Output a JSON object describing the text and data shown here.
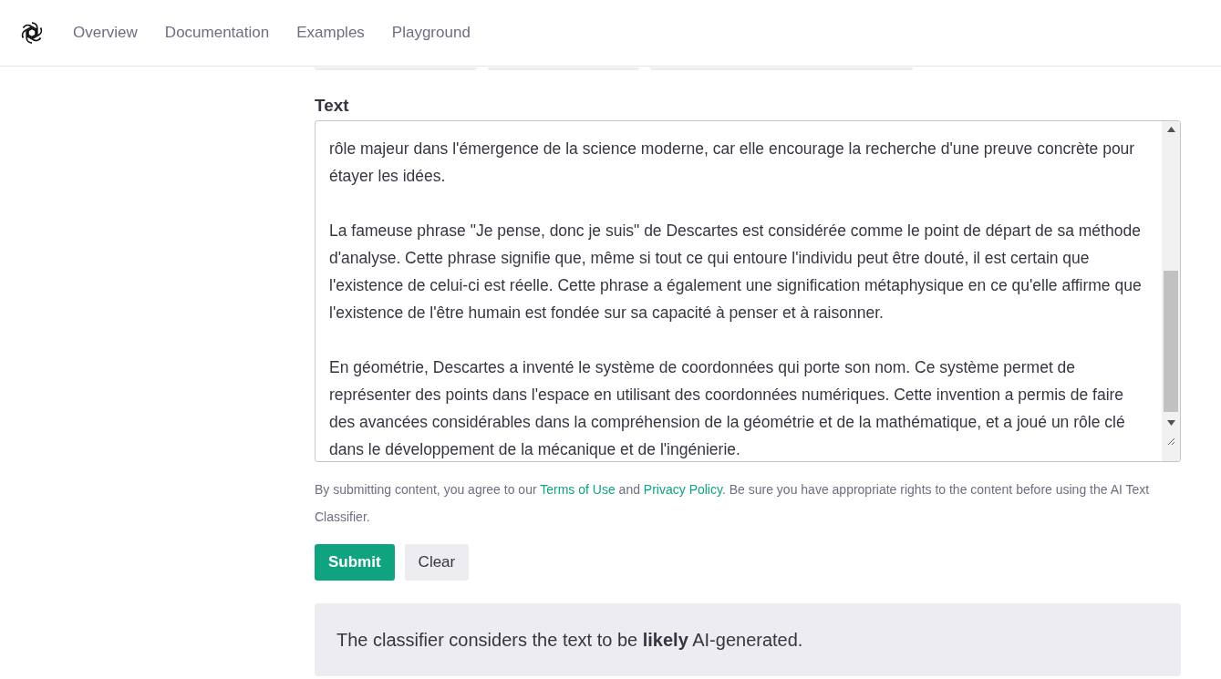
{
  "nav": {
    "links": [
      {
        "label": "Overview"
      },
      {
        "label": "Documentation"
      },
      {
        "label": "Examples"
      },
      {
        "label": "Playground"
      }
    ]
  },
  "form": {
    "label": "Text",
    "paragraphs": [
      "rôle majeur dans l'émergence de la science moderne, car elle encourage la recherche d'une preuve concrète pour étayer les idées.",
      "La fameuse phrase \"Je pense, donc je suis\" de Descartes est considérée comme le point de départ de sa méthode d'analyse. Cette phrase signifie que, même si tout ce qui entoure l'individu peut être douté, il est certain que l'existence de celui-ci est réelle. Cette phrase a également une signification métaphysique en ce qu'elle affirme que l'existence de l'être humain est fondée sur sa capacité à penser et à raisonner.",
      "En géométrie, Descartes a inventé le système de coordonnées qui porte son nom. Ce système permet de représenter des points dans l'espace en utilisant des coordonnées numériques. Cette invention a permis de faire des avancées considérables dans la compréhension de la géométrie et de la mathématique, et a joué un rôle clé dans le développement de la mécanique et de l'ingénierie."
    ],
    "disclaimer": [
      {
        "kind": "text",
        "text": "By submitting content, you agree to our "
      },
      {
        "kind": "link",
        "text": "Terms of Use"
      },
      {
        "kind": "text",
        "text": " and "
      },
      {
        "kind": "link",
        "text": "Privacy Policy"
      },
      {
        "kind": "text",
        "text": ". Be sure you have appropriate rights to the content before using the AI Text Classifier."
      }
    ],
    "buttons": [
      {
        "label": "Submit",
        "kind": "primary"
      },
      {
        "label": "Clear",
        "kind": "secondary"
      }
    ]
  },
  "result": {
    "text": "The classifier considers the text to be **likely** AI-generated."
  }
}
